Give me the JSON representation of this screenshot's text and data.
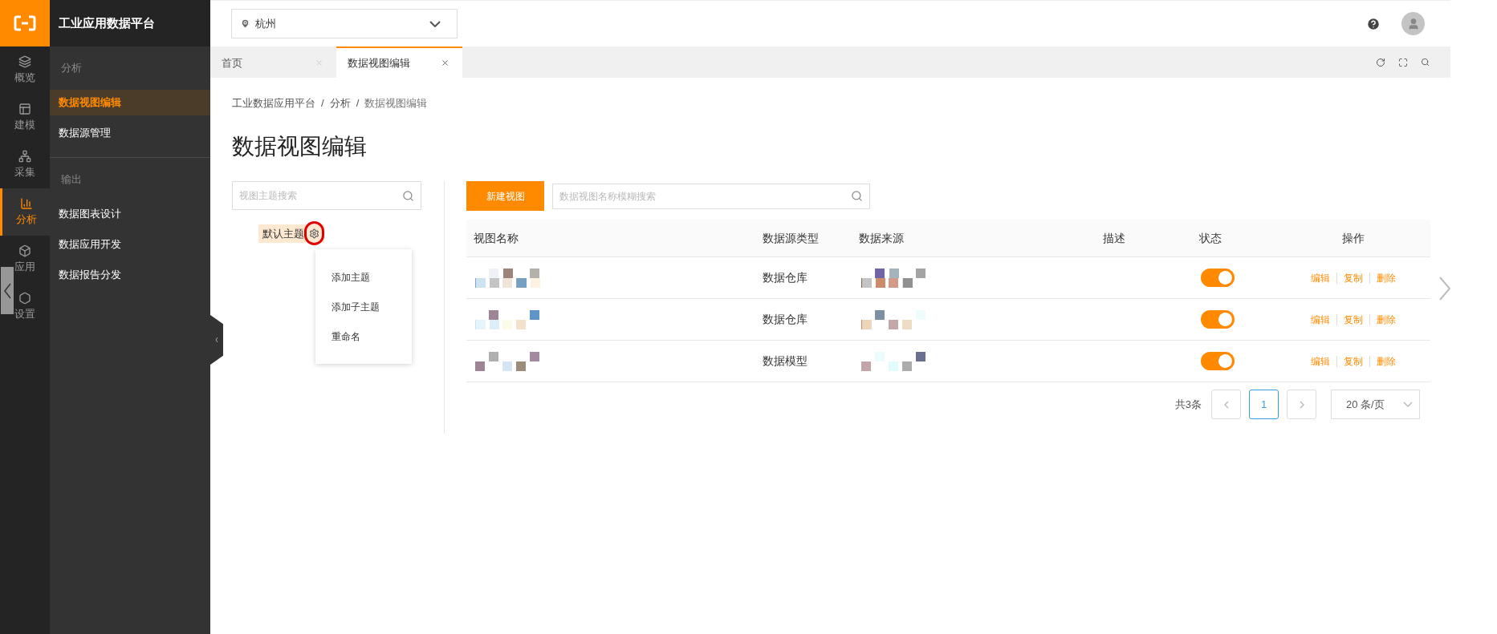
{
  "app_title": "工业应用数据平台",
  "rail": [
    {
      "label": "概览",
      "selected": false
    },
    {
      "label": "建模",
      "selected": false
    },
    {
      "label": "采集",
      "selected": false
    },
    {
      "label": "分析",
      "selected": true
    },
    {
      "label": "应用",
      "selected": false
    },
    {
      "label": "设置",
      "selected": false
    }
  ],
  "nav": [
    {
      "heading": "分析",
      "items": [
        {
          "label": "数据视图编辑",
          "selected": true
        },
        {
          "label": "数据源管理",
          "selected": false
        }
      ]
    },
    {
      "heading": "输出",
      "items": [
        {
          "label": "数据图表设计",
          "selected": false
        },
        {
          "label": "数据应用开发",
          "selected": false
        },
        {
          "label": "数据报告分发",
          "selected": false
        }
      ]
    }
  ],
  "location": {
    "value": "杭州"
  },
  "tabs": [
    {
      "label": "首页",
      "selected": false
    },
    {
      "label": "数据视图编辑",
      "selected": true
    }
  ],
  "breadcrumb": [
    "工业数据应用平台",
    "分析",
    "数据视图编辑"
  ],
  "breadcrumb_separator": "/",
  "page_title": "数据视图编辑",
  "theme_search": {
    "placeholder": "视图主题搜索"
  },
  "tree": [
    {
      "label": "默认主题",
      "selected": true
    }
  ],
  "context_menu": [
    "添加主题",
    "添加子主题",
    "重命名"
  ],
  "new_button": "新建视图",
  "view_search": {
    "placeholder": "数据视图名称模糊搜索"
  },
  "table": {
    "columns": [
      "视图名称",
      "数据源类型",
      "数据来源",
      "描述",
      "状态",
      "操作"
    ],
    "rows": [
      {
        "source_type": "数据仓库",
        "on": true,
        "actions": [
          "编辑",
          "复制",
          "删除"
        ]
      },
      {
        "source_type": "数据仓库",
        "on": true,
        "actions": [
          "编辑",
          "复制",
          "删除"
        ]
      },
      {
        "source_type": "数据模型",
        "on": true,
        "actions": [
          "编辑",
          "复制",
          "删除"
        ]
      }
    ]
  },
  "pagination": {
    "total": "共3条",
    "pages": [
      {
        "label": "1",
        "selected": true
      }
    ],
    "page_size": "20 条/页"
  }
}
